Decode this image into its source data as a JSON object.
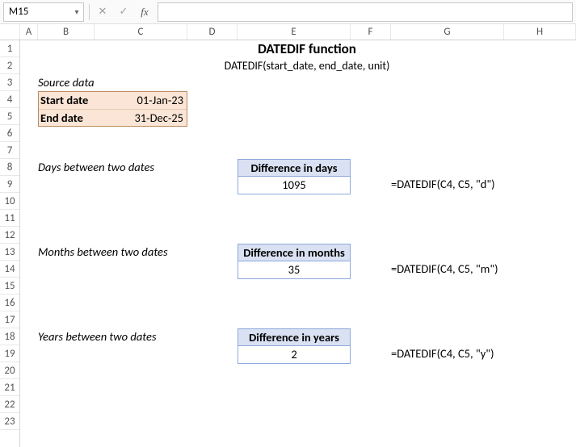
{
  "namebox": "M15",
  "columns": {
    "spacer": 25,
    "A": 22,
    "B": 70,
    "C": 115,
    "D": 62,
    "E": 140,
    "F": 50,
    "G": 140,
    "H": 89
  },
  "title": "DATEDIF function",
  "subtitle": "DATEDIF(start_date, end_date, unit)",
  "source_label": "Source data",
  "source": {
    "start_label": "Start date",
    "start_val": "01-Jan-23",
    "end_label": "End date",
    "end_val": "31-Dec-25"
  },
  "sections": {
    "days": {
      "label": "Days between two dates",
      "box_header": "Difference in days",
      "box_value": "1095",
      "formula": "=DATEDIF(C4, C5, \"d\")"
    },
    "months": {
      "label": "Months between two dates",
      "box_header": "Difference in months",
      "box_value": "35",
      "formula": "=DATEDIF(C4, C5, \"m\")"
    },
    "years": {
      "label": "Years between two dates",
      "box_header": "Difference in years",
      "box_value": "2",
      "formula": "=DATEDIF(C4, C5, \"y\")"
    }
  },
  "chart_data": {
    "type": "table",
    "title": "DATEDIF function",
    "start_date": "01-Jan-23",
    "end_date": "31-Dec-25",
    "rows": [
      {
        "unit": "d",
        "label": "Difference in days",
        "value": 1095,
        "formula": "=DATEDIF(C4, C5, \"d\")"
      },
      {
        "unit": "m",
        "label": "Difference in months",
        "value": 35,
        "formula": "=DATEDIF(C4, C5, \"m\")"
      },
      {
        "unit": "y",
        "label": "Difference in years",
        "value": 2,
        "formula": "=DATEDIF(C4, C5, \"y\")"
      }
    ]
  }
}
